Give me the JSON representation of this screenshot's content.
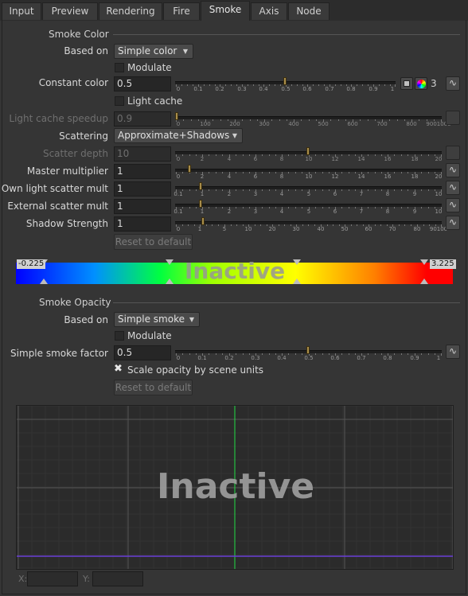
{
  "tabs": [
    "Input",
    "Preview",
    "Rendering",
    "Fire",
    "Smoke",
    "Axis",
    "Node"
  ],
  "active_tab": "Smoke",
  "smoke_color": {
    "section_title": "Smoke Color",
    "based_on_label": "Based on",
    "based_on_value": "Simple color",
    "modulate_label": "Modulate",
    "constant_color_label": "Constant color",
    "constant_color_value": "0.5",
    "constant_color_slider": {
      "ticks": [
        "0",
        "0.1",
        "0.2",
        "0.3",
        "0.4",
        "0.5",
        "0.6",
        "0.7",
        "0.8",
        "0.9",
        "1"
      ],
      "fraction": 0.5
    },
    "color_count": "3",
    "light_cache_label": "Light cache",
    "light_cache_speedup_label": "Light cache speedup",
    "light_cache_speedup_value": "0.9",
    "light_cache_slider": {
      "ticks": [
        "0",
        "100",
        "200",
        "300",
        "400",
        "500",
        "600",
        "700",
        "800",
        "9001000"
      ],
      "fraction": 0.0
    },
    "scattering_label": "Scattering",
    "scattering_value": "Approximate+Shadows",
    "scatter_depth_label": "Scatter depth",
    "scatter_depth_value": "10",
    "scatter_depth_slider": {
      "ticks": [
        "0",
        "2",
        "4",
        "6",
        "8",
        "10",
        "12",
        "14",
        "16",
        "18",
        "20"
      ],
      "fraction": 0.5
    },
    "master_multiplier_label": "Master multiplier",
    "master_multiplier_value": "1",
    "master_multiplier_slider": {
      "ticks": [
        "0",
        "2",
        "4",
        "6",
        "8",
        "10",
        "12",
        "14",
        "16",
        "18",
        "20"
      ],
      "fraction": 0.05
    },
    "own_light_label": "Own light scatter mult",
    "own_light_value": "1",
    "own_light_slider": {
      "ticks": [
        "0.1",
        "1",
        "2",
        "3",
        "4",
        "5",
        "6",
        "7",
        "8",
        "9",
        "10"
      ],
      "fraction": 0.09
    },
    "external_label": "External scatter mult",
    "external_value": "1",
    "external_slider": {
      "ticks": [
        "0.1",
        "1",
        "2",
        "3",
        "4",
        "5",
        "6",
        "7",
        "8",
        "9",
        "10"
      ],
      "fraction": 0.09
    },
    "shadow_label": "Shadow Strength",
    "shadow_value": "1",
    "shadow_slider": {
      "ticks": [
        "0",
        "1",
        "5",
        "10",
        "20",
        "30",
        "40",
        "50",
        "60",
        "70",
        "80",
        "90100"
      ],
      "fraction": 0.1
    },
    "reset_label": "Reset to default"
  },
  "color_ramp": {
    "min_value": "-0.225",
    "max_value": "3.225",
    "overlay_text": "Inactive"
  },
  "smoke_opacity": {
    "section_title": "Smoke Opacity",
    "based_on_label": "Based on",
    "based_on_value": "Simple smoke",
    "modulate_label": "Modulate",
    "factor_label": "Simple smoke factor",
    "factor_value": "0.5",
    "factor_slider": {
      "ticks": [
        "0",
        "0.1",
        "0.2",
        "0.3",
        "0.4",
        "0.5",
        "0.6",
        "0.7",
        "0.8",
        "0.9",
        "1"
      ],
      "fraction": 0.5
    },
    "scale_opacity_label": "Scale opacity by scene units",
    "reset_label": "Reset to default"
  },
  "curve_editor": {
    "overlay_text": "Inactive",
    "x_label": "X:",
    "y_label": "Y:"
  }
}
